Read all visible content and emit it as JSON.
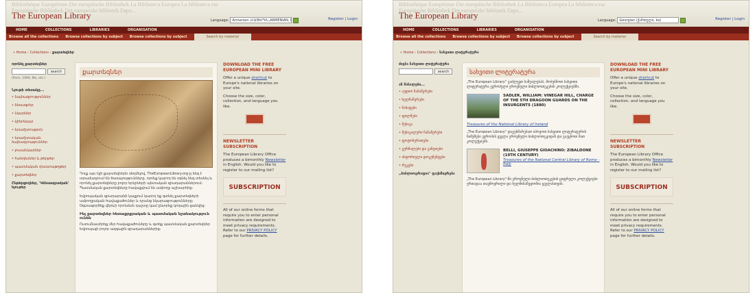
{
  "left": {
    "title": "The European Library",
    "taglines": [
      "Bibliothèque Européenne  Die europäische Bibliothek  La Biblioteca Europea  La biblioteca europea",
      "Europäische Bibliothek  Det europeiske bibliotek  Евро..."
    ],
    "language_label": "Language:",
    "language_value": "Armenian (ՀԱՅԵՐԵՆ,ARMENIAN, hy)",
    "register": "Register",
    "login": "Login",
    "nav": [
      "HOME",
      "COLLECTIONS",
      "LIBRARIES",
      "ORGANISATION"
    ],
    "subnav": [
      "Browse all the collections",
      "Browse collections by subject",
      "Browse collections by subject",
      "Search by material"
    ],
    "breadcrumb": [
      "Home",
      "Collections",
      "քարտեզներ"
    ],
    "sidebar_search_label": "որոնել քարտեզներ",
    "search_button": "search",
    "search_hint": "(Paris, 1900, Ma, etc.)",
    "sidebar_group": "Նյութի տեսակը...",
    "sidebar_items": [
      "ձայնագրություններ",
      "ձեռագրեր",
      "նկարներ",
      "կինոնկար",
      "երաժշտություն",
      "երաժշտական ձայնագրություններ",
      "լուսանկարներ",
      "հանդեսներ և թերթեր",
      "պատմական փաստաթղթեր",
      "քարտեզներ"
    ],
    "sidebar_footer": "Ընթերցողներ, 'Կենսագրական' նյութեր",
    "main_heading": "քարտեզներ",
    "main_paragraph1": "Դուք այս էջի քարտեզներն սեղմելով, TheEuropeanLibrary.org-ը ձեզ է տրամադրում են ծառայությունները, որոնք կարող են օգնել ձեզ տեսնել և որոնել քարտեզները բոլոր երկրների պետական գրադարաններում։ Պատմական քարտեզները հավաքվում են ամբողջ աշխարհից։",
    "main_paragraph2": "Եվրոպական գրադարանի կայքում կարող եք գտնել քարտեզների ամբողջական հավաքածուներ և դրանց նկարագրությունները։ Օգտագործեք վերևի որոնման դաշտը կամ ընտրեք կողային ցանկից։",
    "main_subheading": "Ինչ քարտեզներ հետաքրքրական և պատմական նշանակություն ունեն",
    "main_paragraph3": "Ուսումնասիրեք մեր հավաքածուները և գտեք պատմական քարտեզներ Եվրոպայի բոլոր ազգային գրադարաններից։",
    "rp_download_title": "DOWNLOAD THE FREE EUROPEAN MINI LIBRARY",
    "rp_offer": "Offer a unique",
    "rp_shortcut": "shortcut",
    "rp_offer2": "to Europe's national libraries on your site.",
    "rp_choose": "Choose the size, color, collection, and language you like.",
    "rp_news_title": "NEWSLETTER SUBSCRIPTION",
    "rp_news1": "The European Library Office produces a bimonthly",
    "rp_newsletter": "Newsletter",
    "rp_news2": "in English. Would you like to register to our mailing list?",
    "rp_subscription": "SUBSCRIPTION",
    "rp_privacy1": "All of our online forms that require you to enter personal information are designed to meet privacy requirements. Refer to our",
    "rp_privacy_link": "PRIVACY POLICY",
    "rp_privacy2": "page for further details."
  },
  "right": {
    "title": "The European Library",
    "taglines": [
      "Bibliothèque Européenne  Die europäische Bibliothek  La Biblioteca Europea  La biblioteca europea",
      "Europäische Bibliothek  Det europeiske bibliotek  Евро..."
    ],
    "language_label": "Language:",
    "language_value": "Georgian (ქართული, ka)",
    "register": "Register",
    "login": "Login",
    "nav": [
      "HOME",
      "COLLECTIONS",
      "LIBRARIES",
      "ORGANISATION"
    ],
    "subnav": [
      "Browse all the collections",
      "Browse collections by subject",
      "Browse collections by subject",
      "Search by material"
    ],
    "breadcrumb": [
      "Home",
      "Collections",
      "სახვითი ლიტერატურა"
    ],
    "sidebar_search_label": "ძიება სახვითი ლიტერატურა",
    "search_button": "search",
    "search_hint": "",
    "sidebar_group": "ან მასალები...",
    "sidebar_items": [
      "აუდიო ჩანაწერები",
      "ხელნაწერები",
      "ნახატები",
      "ფილმები",
      "მუსიკა",
      "მუსიკალური ჩანაწერები",
      "ფოტოსურათები",
      "ჟურნალები და გაზეთები",
      "ისტორიული დოკუმენტები",
      "რუკები"
    ],
    "sidebar_footer": "„ბიბლიოგრაფია\" ფაქიზიერება",
    "main_heading": "სახვითი ლიტერატურა",
    "main_paragraph1": "„The European Library\" გაძლევთ საშუალებას, მოძებნოთ სახვითი ლიტერატურა ევროპული ეროვნული ბიბლიოთეკების კოლექციებში.",
    "card1_title": "SADLER, WILLIAM: VINEGAR HILL, CHARGE OF THE 5TH DRAGOON GUARDS ON THE INSURGENTS (1880)",
    "card1_link": "Treasures of the National Library of Ireland",
    "main_paragraph2": "„The European Library\" დაგეხმარებათ იპოვოთ სახვითი ლიტერატურის ნიმუშები ევროპის ყველა ეროვნული ბიბლიოთეკიდან და გაეცნოთ მათ კოლექციებს.",
    "card2_title": "BELLI, GIUSEPPE GIOACHINO: ZIBALDONE (19TH CENTURY)",
    "card2_link": "Treasures of the National Central Library of Rome - Italy",
    "main_paragraph3": "„The European Library\"-ში ეროვნული ბიბლიოთეკების ციფრული კოლექციები ერთადაა თავმოყრილი და ხელმისაწვდომია ყველასთვის.",
    "rp_download_title": "DOWNLOAD THE FREE EUROPEAN MINI LIBRARY",
    "rp_offer": "Offer a unique",
    "rp_shortcut": "shortcut",
    "rp_offer2": "to Europe's national libraries on your site.",
    "rp_choose": "Choose the size, color, collection, and language you like.",
    "rp_news_title": "NEWSLETTER SUBSCRIPTION",
    "rp_news1": "The European Library Office produces a bimonthly",
    "rp_newsletter": "Newsletter",
    "rp_news2": "in English. Would you like to register to our mailing list?",
    "rp_subscription": "SUBSCRIPTION",
    "rp_privacy1": "All of our online forms that require you to enter personal information are designed to meet privacy requirements. Refer to our",
    "rp_privacy_link": "PRIVACY POLICY",
    "rp_privacy2": "page for further details."
  }
}
